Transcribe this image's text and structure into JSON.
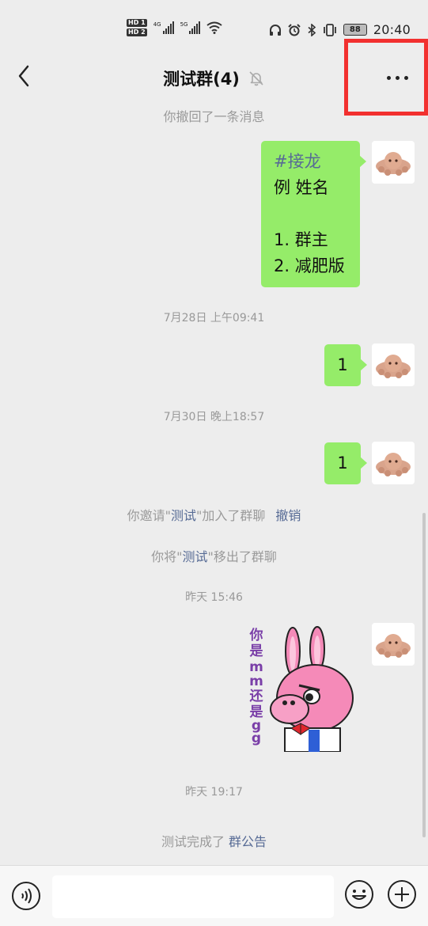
{
  "status_bar": {
    "hd1": "HD 1",
    "hd2": "HD 2",
    "sig1_label": "4G",
    "sig2_label": "5G",
    "battery": "88",
    "time": "20:40"
  },
  "header": {
    "title": "测试群(4)",
    "back_icon": "chevron-left-icon",
    "mute_icon": "bell-off-icon",
    "more_icon": "more-dots-icon",
    "highlight_color": "#f2302f"
  },
  "messages": {
    "recall_notice": "你撤回了一条消息",
    "bubble1": {
      "lines": [
        "#接龙",
        "例 姓名",
        "",
        "1. 群主",
        "2. 减肥版"
      ]
    },
    "ts1": "7月28日 上午09:41",
    "bubble2": "1",
    "ts2": "7月30日 晚上18:57",
    "bubble3": "1",
    "invite": {
      "pre": "你邀请\"",
      "name": "测试",
      "post": "\"加入了群聊",
      "action": "撤销"
    },
    "remove": {
      "pre": "你将\"",
      "name": "测试",
      "post": "\"移出了群聊"
    },
    "ts3": "昨天 15:46",
    "sticker_text": "你是mm还是gg",
    "ts4": "昨天 19:17",
    "completed": {
      "pre": "测试完成了 ",
      "link": "群公告"
    }
  },
  "input_bar": {
    "placeholder": "",
    "voice_icon": "voice-icon",
    "emoji_icon": "emoji-icon",
    "plus_icon": "plus-icon"
  },
  "colors": {
    "bubble": "#95ec69",
    "link": "#576b95",
    "background": "#ededed"
  }
}
